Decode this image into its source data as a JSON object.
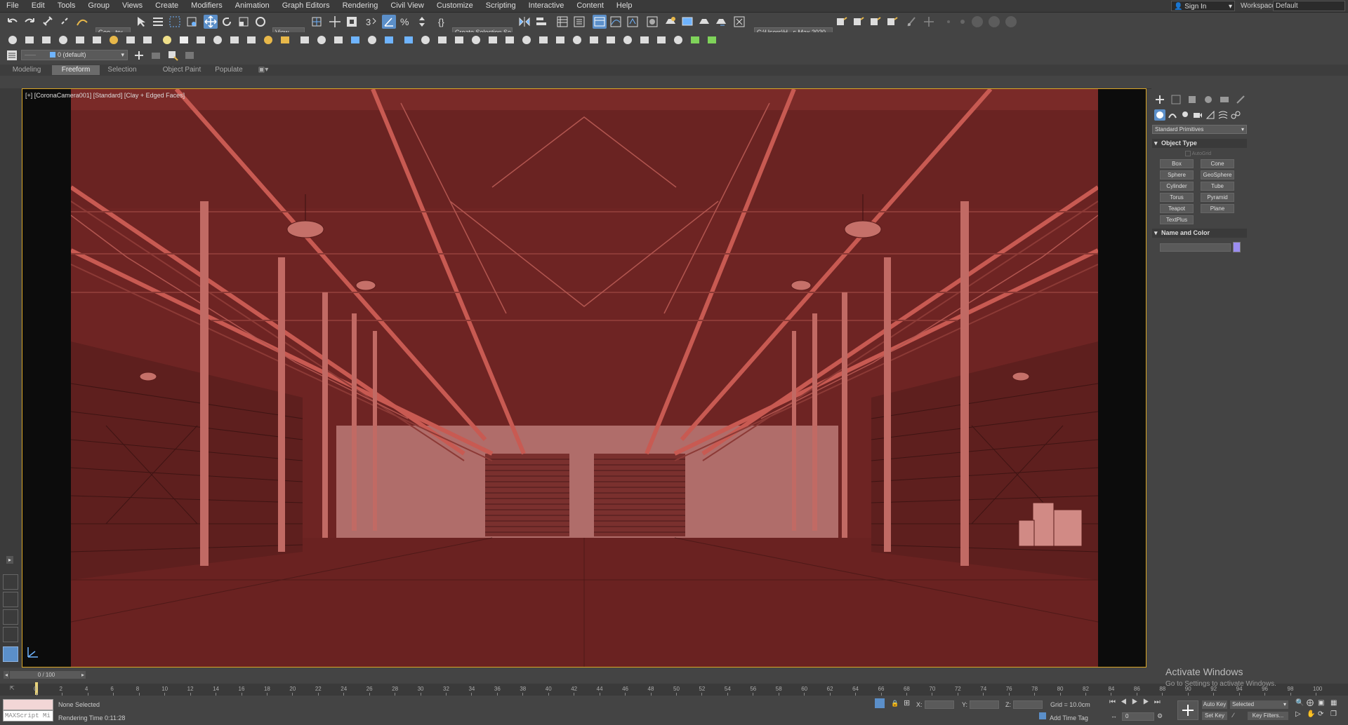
{
  "menu": [
    "File",
    "Edit",
    "Tools",
    "Group",
    "Views",
    "Create",
    "Modifiers",
    "Animation",
    "Graph Editors",
    "Rendering",
    "Civil View",
    "Customize",
    "Scripting",
    "Interactive",
    "Content",
    "Help"
  ],
  "account": {
    "signin": "Sign In",
    "workspaces_label": "Workspaces:",
    "workspace_value": "Default"
  },
  "toolbar": {
    "selection_filter": "Geo...try",
    "ref_coord": "View",
    "named_selection": "Create Selection Se",
    "project_path": "C:\\Users\\H...s Max 2020",
    "layer": "0 (default)"
  },
  "ribbon_tabs": [
    "Modeling",
    "Freeform",
    "Selection",
    "Object Paint",
    "Populate"
  ],
  "ribbon_active": "Freeform",
  "viewport": {
    "label": "[+] [CoronaCamera001] [Standard] [Clay + Edged Faces]"
  },
  "command_panel": {
    "category": "Standard Primitives",
    "object_type_title": "Object Type",
    "autogrid": "AutoGrid",
    "buttons": [
      "Box",
      "Cone",
      "Sphere",
      "GeoSphere",
      "Cylinder",
      "Tube",
      "Torus",
      "Pyramid",
      "Teapot",
      "Plane",
      "TextPlus"
    ],
    "name_color_title": "Name and Color",
    "object_color": "#9b8df0"
  },
  "timeline": {
    "frame": "0 / 100",
    "ticks": [
      "0",
      "2",
      "4",
      "6",
      "8",
      "10",
      "12",
      "14",
      "16",
      "18",
      "20",
      "22",
      "24",
      "26",
      "28",
      "30",
      "32",
      "34",
      "36",
      "38",
      "40",
      "42",
      "44",
      "46",
      "48",
      "50",
      "52",
      "54",
      "56",
      "58",
      "60",
      "62",
      "64",
      "66",
      "68",
      "70",
      "72",
      "74",
      "76",
      "78",
      "80",
      "82",
      "84",
      "86",
      "88",
      "90",
      "92",
      "94",
      "96",
      "98",
      "100"
    ]
  },
  "status": {
    "maxscript": "MAXScript Mi",
    "selection": "None Selected",
    "render_time": "Rendering Time  0:11:28",
    "x_label": "X:",
    "y_label": "Y:",
    "z_label": "Z:",
    "grid": "Grid = 10.0cm",
    "add_time_tag": "Add Time Tag",
    "auto_key": "Auto Key",
    "set_key": "Set Key",
    "selected": "Selected",
    "key_filters": "Key Filters...",
    "frame_field": "0"
  },
  "activate_windows": {
    "title": "Activate Windows",
    "subtitle": "Go to Settings to activate Windows."
  },
  "colors": {
    "viewport_border": "#d9a626",
    "scene_base": "#6e2423",
    "scene_light": "#b06d6a",
    "truss": "#c85a52"
  }
}
